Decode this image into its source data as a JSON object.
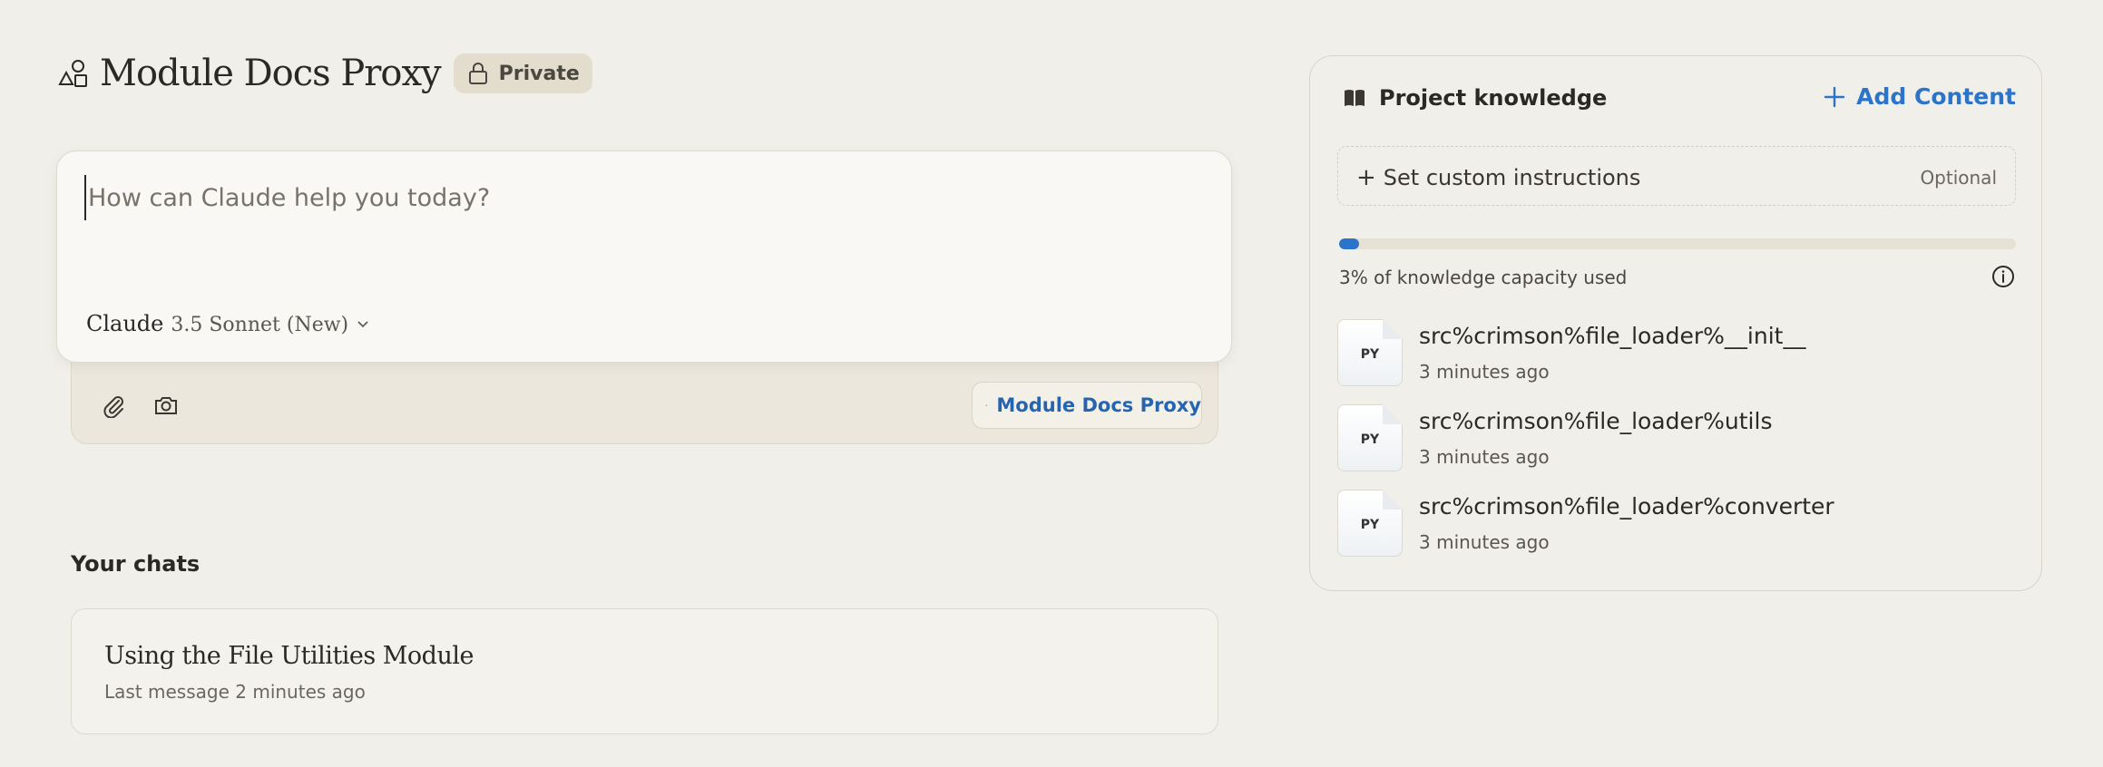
{
  "project": {
    "title": "Module Docs Proxy",
    "privacy_label": "Private"
  },
  "composer": {
    "placeholder": "How can Claude help you today?",
    "model_brand": "Claude",
    "model_name": "3.5 Sonnet (New)",
    "project_chip_label": "Module Docs Proxy"
  },
  "chats": {
    "heading": "Your chats",
    "items": [
      {
        "title": "Using the File Utilities Module",
        "meta": "Last message 2 minutes ago"
      }
    ]
  },
  "knowledge": {
    "title": "Project knowledge",
    "add_label": "Add Content",
    "custom_instructions_label": "Set custom instructions",
    "custom_instructions_optional": "Optional",
    "capacity_fraction": 0.03,
    "capacity_text": "3% of knowledge capacity used",
    "files": [
      {
        "ext": "PY",
        "name": "src%crimson%file_loader%__init__",
        "time": "3 minutes ago"
      },
      {
        "ext": "PY",
        "name": "src%crimson%file_loader%utils",
        "time": "3 minutes ago"
      },
      {
        "ext": "PY",
        "name": "src%crimson%file_loader%converter",
        "time": "3 minutes ago"
      }
    ]
  },
  "colors": {
    "background": "#f1efe9",
    "accent_blue": "#2c74c9",
    "badge_bg": "#e3ddcd"
  },
  "icons": {
    "project": "shapes-icon",
    "private": "lock-icon",
    "attach": "paperclip-icon",
    "camera": "camera-icon",
    "knowledge": "book-icon",
    "add": "plus-icon",
    "info": "info-icon"
  }
}
